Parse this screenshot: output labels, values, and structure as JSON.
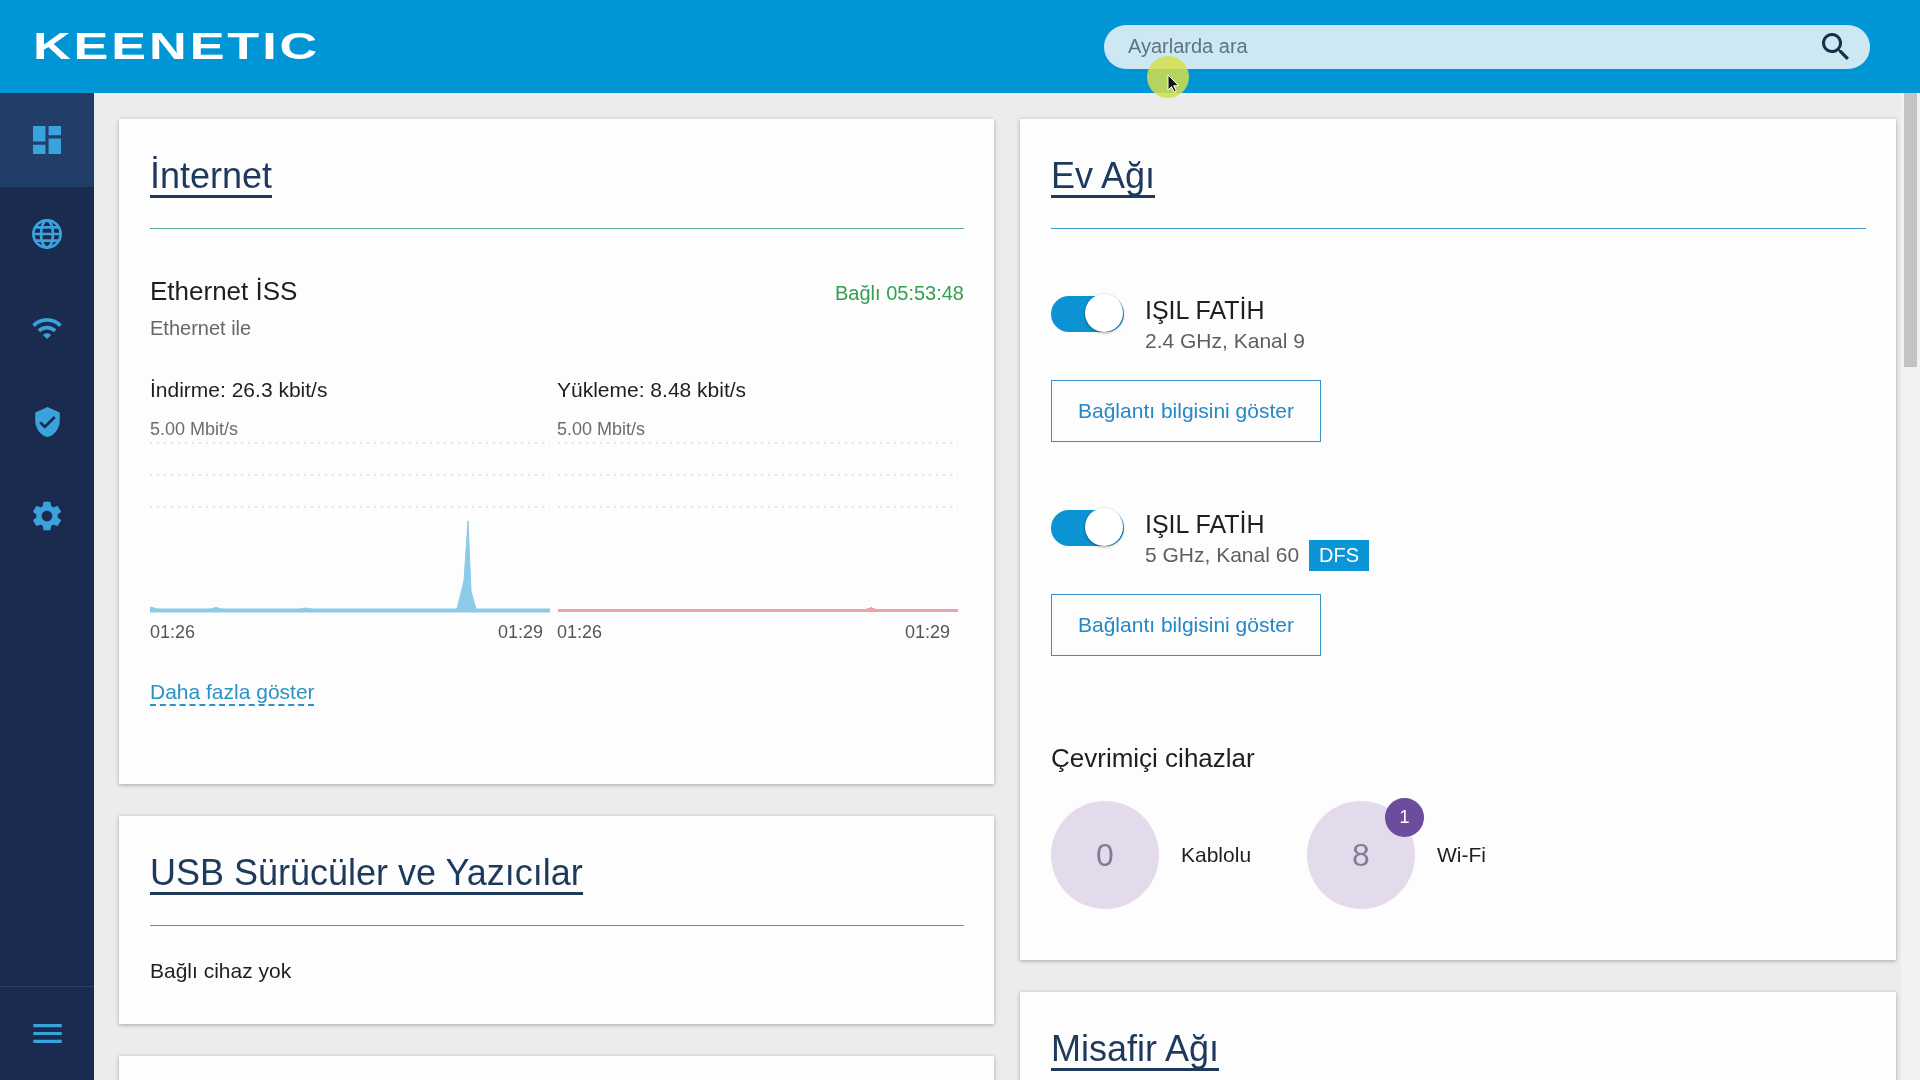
{
  "header": {
    "logo": "KEENETIC",
    "search": {
      "placeholder": "Ayarlarda ara"
    }
  },
  "sidebar": {
    "items": [
      {
        "selected": true
      },
      {
        "selected": false
      },
      {
        "selected": false
      },
      {
        "selected": false
      },
      {
        "selected": false
      }
    ]
  },
  "internet": {
    "title": "İnternet",
    "connection": {
      "name": "Ethernet İSS",
      "type": "Ethernet ile",
      "status": "Bağlı 05:53:48"
    },
    "traffic": [
      {
        "label": "İndirme: 26.3 kbit/s",
        "scale": "5.00 Mbit/s",
        "color": "#8ccbe8",
        "times": [
          "01:26",
          "01:29"
        ]
      },
      {
        "label": "Yükleme: 8.48 kbit/s",
        "scale": "5.00 Mbit/s",
        "color": "#eea3ac",
        "times": [
          "01:26",
          "01:29"
        ]
      }
    ],
    "more_link": "Daha fazla göster"
  },
  "usb": {
    "title": "USB Sürücüler ve Yazıcılar",
    "message": "Bağlı cihaz yok"
  },
  "home_network": {
    "title": "Ev Ağı",
    "networks": [
      {
        "name": "IŞIL FATİH",
        "on": true,
        "band": "2.4 GHz, Kanal 9",
        "button": "Bağlantı bilgisini göster"
      },
      {
        "name": "IŞIL FATİH",
        "on": true,
        "band": "5 GHz, Kanal 60",
        "badge": "DFS",
        "button": "Bağlantı bilgisini göster"
      }
    ],
    "online": {
      "title": "Çevrimiçi cihazlar",
      "groups": [
        {
          "count": "0",
          "label": "Kablolu"
        },
        {
          "count": "8",
          "label": "Wi-Fi",
          "badge": "1"
        }
      ]
    }
  },
  "guest_network": {
    "title": "Misafir Ağı"
  }
}
